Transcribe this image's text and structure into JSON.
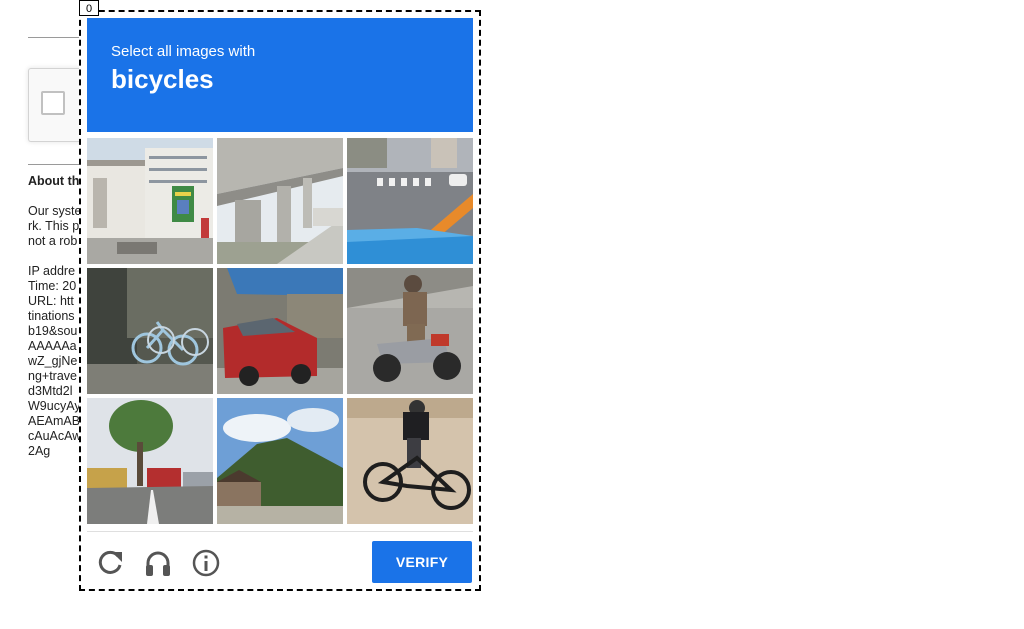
{
  "background_page": {
    "about_title": "About th",
    "paragraph_1": [
      "Our syste",
      "rk. This p",
      "not a rob"
    ],
    "paragraph_2": [
      "IP addre",
      "Time: 20",
      "URL: htt",
      "tinations",
      "b19&sou",
      "AAAAAa",
      "wZ_gjNe",
      "ng+trave",
      "d3Mtd2l",
      "W9ucyAy",
      "AEAmAB",
      "cAuAcAw",
      "2Ag"
    ]
  },
  "challenge": {
    "counter": "0",
    "instruction": "Select all images with",
    "target": "bicycles",
    "tiles": [
      {
        "scene": "building-with-sign"
      },
      {
        "scene": "elevated-highway-pillars"
      },
      {
        "scene": "road-crosswalk-car-hood"
      },
      {
        "scene": "parked-bicycles-wall"
      },
      {
        "scene": "red-car-under-tarp"
      },
      {
        "scene": "motorcyclist-on-road"
      },
      {
        "scene": "street-tree-bus"
      },
      {
        "scene": "hills-houses"
      },
      {
        "scene": "cyclist-on-dirt-bike"
      }
    ],
    "footer": {
      "reload_icon": "reload-icon",
      "audio_icon": "headphones-icon",
      "info_icon": "info-icon",
      "verify_label": "VERIFY"
    },
    "colors": {
      "accent": "#1a73e8"
    }
  }
}
